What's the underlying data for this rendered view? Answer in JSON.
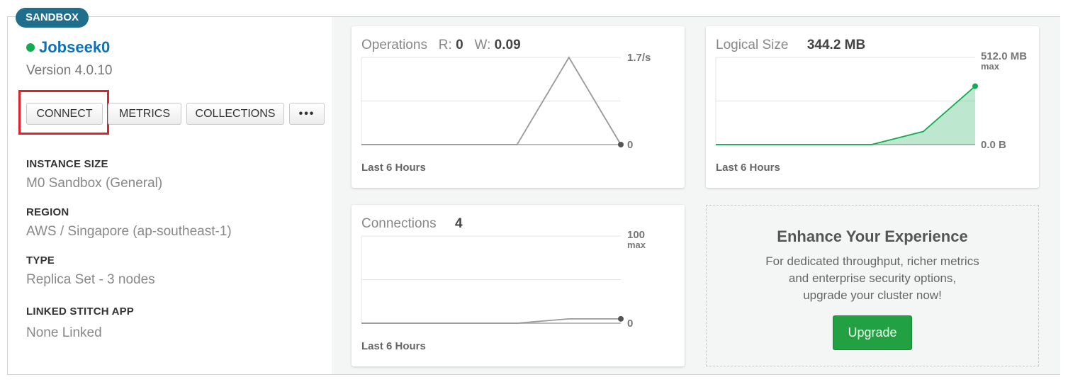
{
  "badge": "SANDBOX",
  "cluster": {
    "name": "Jobseek0",
    "status_color": "#13aa52",
    "version": "Version 4.0.10"
  },
  "buttons": {
    "connect": "CONNECT",
    "metrics": "METRICS",
    "collections": "COLLECTIONS",
    "more": "•••"
  },
  "props": [
    {
      "label": "INSTANCE SIZE",
      "value": "M0 Sandbox (General)"
    },
    {
      "label": "REGION",
      "value": "AWS / Singapore (ap-southeast-1)"
    },
    {
      "label": "TYPE",
      "value": "Replica Set - 3 nodes"
    },
    {
      "label": "LINKED STITCH APP",
      "value": "None Linked"
    }
  ],
  "panels": {
    "operations": {
      "title": "Operations",
      "r_label": "R:",
      "r_value": "0",
      "w_label": "W:",
      "w_value": "0.09",
      "max_label": "1.7/s",
      "min_label": "0",
      "footer": "Last 6 Hours",
      "series": [
        0,
        0,
        0,
        0,
        1,
        0
      ]
    },
    "logical_size": {
      "title": "Logical Size",
      "value": "344.2 MB",
      "max_label": "512.0 MB",
      "max_sub": "max",
      "min_label": "0.0 B",
      "footer": "Last 6 Hours",
      "series": [
        0,
        0,
        0,
        0,
        0.15,
        0.67
      ]
    },
    "connections": {
      "title": "Connections",
      "value": "4",
      "max_label": "100",
      "max_sub": "max",
      "min_label": "0",
      "footer": "Last 6 Hours",
      "series": [
        0,
        0,
        0,
        0,
        0.05,
        0.05
      ]
    }
  },
  "upsell": {
    "title": "Enhance Your Experience",
    "line1": "For dedicated throughput, richer metrics",
    "line2": "and enterprise security options,",
    "line3": "upgrade your cluster now!",
    "button": "Upgrade"
  }
}
